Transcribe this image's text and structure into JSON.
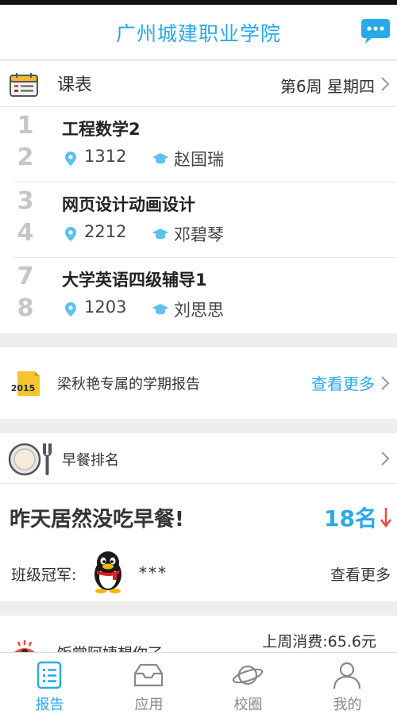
{
  "header": {
    "title": "广州城建职业学院",
    "chat_icon": "chat-bubble-icon"
  },
  "schedule": {
    "title": "课表",
    "week_label": "第6周 星期四",
    "courses": [
      {
        "period_start": "1",
        "period_end": "2",
        "name": "工程数学2",
        "room": "1312",
        "teacher": "赵国瑞"
      },
      {
        "period_start": "3",
        "period_end": "4",
        "name": "网页设计动画设计",
        "room": "2212",
        "teacher": "邓碧琴"
      },
      {
        "period_start": "7",
        "period_end": "8",
        "name": "大学英语四级辅导1",
        "room": "1203",
        "teacher": "刘思思"
      }
    ]
  },
  "report": {
    "badge_text": "2015",
    "text": "梁秋艳专属的学期报告",
    "more": "查看更多"
  },
  "breakfast": {
    "title": "早餐排名",
    "message": "昨天居然没吃早餐!",
    "rank": "18名",
    "champion_label": "班级冠军:",
    "champion_name": "***",
    "more": "查看更多"
  },
  "canteen": {
    "text": "饭堂阿姨想你了",
    "spend": "上周消费:65.6元"
  },
  "tabs": [
    {
      "label": "报告",
      "icon": "report-icon",
      "active": true
    },
    {
      "label": "应用",
      "icon": "inbox-icon",
      "active": false
    },
    {
      "label": "校圈",
      "icon": "planet-icon",
      "active": false
    },
    {
      "label": "我的",
      "icon": "person-icon",
      "active": false
    }
  ],
  "colors": {
    "accent": "#29a9e8",
    "alert": "#e84c3d",
    "background": "#eeeeee"
  }
}
